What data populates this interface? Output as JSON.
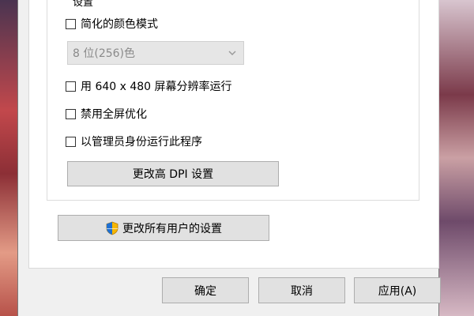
{
  "dialog": {
    "group_title": "设置",
    "checkboxes": [
      {
        "label": "简化的颜色模式",
        "checked": false
      },
      {
        "label": "用 640 x 480 屏幕分辨率运行",
        "checked": false
      },
      {
        "label": "禁用全屏优化",
        "checked": false
      },
      {
        "label": "以管理员身份运行此程序",
        "checked": false
      }
    ],
    "color_select": {
      "value": "8 位(256)色",
      "enabled": false
    },
    "buttons": {
      "change_dpi": "更改高 DPI 设置",
      "change_all_users": "更改所有用户的设置",
      "ok": "确定",
      "cancel": "取消",
      "apply": "应用(A)"
    }
  },
  "icons": {
    "shield": "uac-shield-icon",
    "chevron": "chevron-down-icon"
  },
  "colors": {
    "dialog_bg": "#f0f0f0",
    "panel_bg": "#ffffff",
    "button_bg": "#e1e1e1",
    "button_border": "#adadad",
    "disabled_text": "#8a8a8a"
  }
}
